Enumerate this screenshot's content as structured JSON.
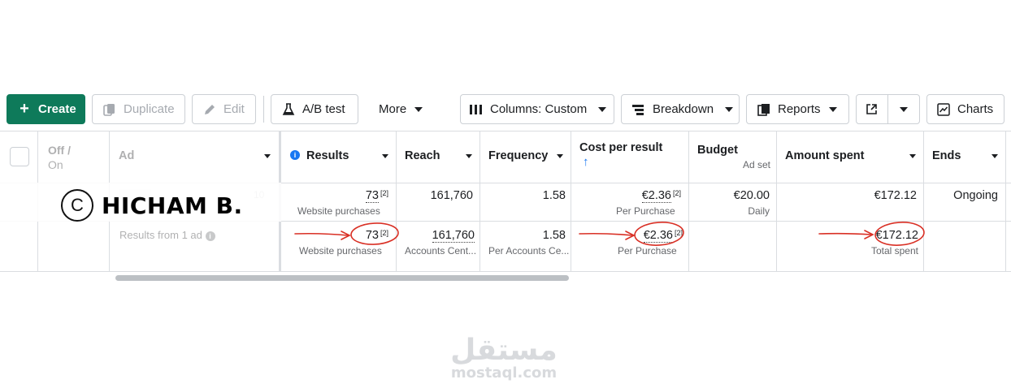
{
  "toolbar": {
    "create": "Create",
    "duplicate": "Duplicate",
    "edit": "Edit",
    "ab_test": "A/B test",
    "more": "More",
    "columns": "Columns: Custom",
    "breakdown": "Breakdown",
    "reports": "Reports",
    "charts": "Charts"
  },
  "table": {
    "headers": {
      "off_on": "Off /",
      "off_on_2": "On",
      "ad": "Ad",
      "results": "Results",
      "reach": "Reach",
      "frequency": "Frequency",
      "cost_per_result": "Cost per result",
      "budget": "Budget",
      "budget_sub": "Ad set",
      "amount_spent": "Amount spent",
      "ends": "Ends"
    },
    "row1": {
      "ad_partial": "10",
      "results": "73",
      "results_sup": "[2]",
      "results_sub": "Website purchases",
      "reach": "161,760",
      "frequency": "1.58",
      "cost": "€2.36",
      "cost_sup": "[2]",
      "cost_sub": "Per Purchase",
      "budget": "€20.00",
      "budget_sub": "Daily",
      "amount": "€172.12",
      "ends": "Ongoing"
    },
    "row2": {
      "ad": "Results from 1 ad",
      "results": "73",
      "results_sup": "[2]",
      "results_sub": "Website purchases",
      "reach": "161,760",
      "reach_sub": "Accounts Cent...",
      "frequency": "1.58",
      "frequency_sub": "Per Accounts Ce...",
      "cost": "€2.36",
      "cost_sup": "[2]",
      "cost_sub": "Per Purchase",
      "amount": "€172.12",
      "amount_sub": "Total spent"
    }
  },
  "watermark": {
    "copyright": "C",
    "name": "HICHAM B.",
    "site_ar": "مستقل",
    "site_en": "mostaql.com"
  },
  "colors": {
    "primary": "#0e7a5a",
    "annotation": "#d93025",
    "info": "#1877f2"
  }
}
